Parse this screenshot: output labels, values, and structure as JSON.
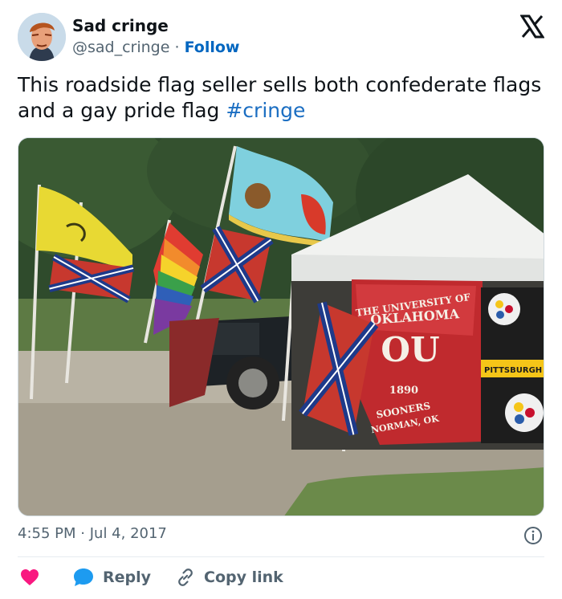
{
  "user": {
    "name": "Sad cringe",
    "handle": "@sad_cringe",
    "separator": "·",
    "follow_label": "Follow"
  },
  "tweet": {
    "text": "This roadside flag seller sells both confederate flags and a gay pride flag",
    "hashtag": "#cringe"
  },
  "meta": {
    "time": "4:55 PM",
    "separator": "·",
    "date": "Jul 4, 2017"
  },
  "actions": {
    "reply_label": "Reply",
    "copy_link_label": "Copy link"
  },
  "photo_sign": {
    "line1": "THE UNIVERSITY OF",
    "line2": "OKLAHOMA",
    "logo": "OU",
    "year": "1890",
    "line3": "SOONERS",
    "line4": "NORMAN, OK",
    "banner": "PITTSBURGH S"
  },
  "colors": {
    "accent": "#0066c0",
    "hashtag": "#1b6ec2",
    "like": "#f91880",
    "reply": "#1d9bf0",
    "text": "#0f1419",
    "muted": "#536471"
  },
  "icons": {
    "logo": "x-logo-icon",
    "info": "info-icon",
    "like": "heart-icon",
    "reply": "reply-bubble-icon",
    "copy": "link-icon"
  }
}
